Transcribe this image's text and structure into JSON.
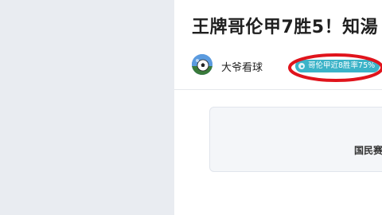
{
  "article": {
    "title": "王牌哥伦甲7胜5！知湯",
    "author": {
      "name": "大爷看球"
    },
    "tag": "哥伦甲近8胜率75%",
    "card": {
      "text": "国民赛"
    }
  },
  "colors": {
    "page_bg": "#e9ecf1",
    "tag_bg": "#3bb3c8",
    "annotation": "#e0141c"
  },
  "icons": {
    "avatar": "soccer-ball-avatar",
    "tag": "tag-badge-icon"
  }
}
